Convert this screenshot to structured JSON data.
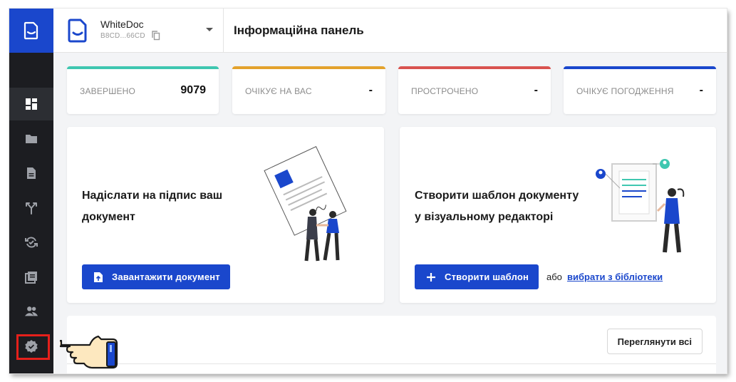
{
  "header": {
    "org_name": "WhiteDoc",
    "org_id": "B8CD...66CD",
    "page_title": "Інформаційна панель"
  },
  "sidebar": {
    "items": [
      {
        "icon": "dashboard-icon",
        "active": true
      },
      {
        "icon": "folder-icon"
      },
      {
        "icon": "document-icon"
      },
      {
        "icon": "workflow-icon"
      },
      {
        "icon": "sync-check-icon"
      },
      {
        "icon": "library-icon"
      },
      {
        "icon": "users-icon"
      },
      {
        "icon": "verified-badge-icon"
      }
    ]
  },
  "stats": [
    {
      "label": "ЗАВЕРШЕНО",
      "value": "9079",
      "color": "#3fc7b0"
    },
    {
      "label": "ОЧІКУЄ НА ВАС",
      "value": "-",
      "color": "#e3a22c"
    },
    {
      "label": "ПРОСТРОЧЕНО",
      "value": "-",
      "color": "#d9534f"
    },
    {
      "label": "ОЧІКУЄ ПОГОДЖЕННЯ",
      "value": "-",
      "color": "#1a47cc"
    }
  ],
  "cards": {
    "sign": {
      "title_line1": "Надіслати на підпис ваш",
      "title_line2": "документ",
      "button": "Завантажити документ"
    },
    "template": {
      "title_line1": "Створити шаблон документу",
      "title_line2": "у візуальному редакторі",
      "button": "Створити шаблон",
      "or_text": "або",
      "link": "вибрати з бібліотеки"
    }
  },
  "bottom": {
    "view_all": "Переглянути всі"
  },
  "colors": {
    "accent": "#1a47cc",
    "sidebar_bg": "#1c1d21",
    "highlight": "#e5201b"
  }
}
